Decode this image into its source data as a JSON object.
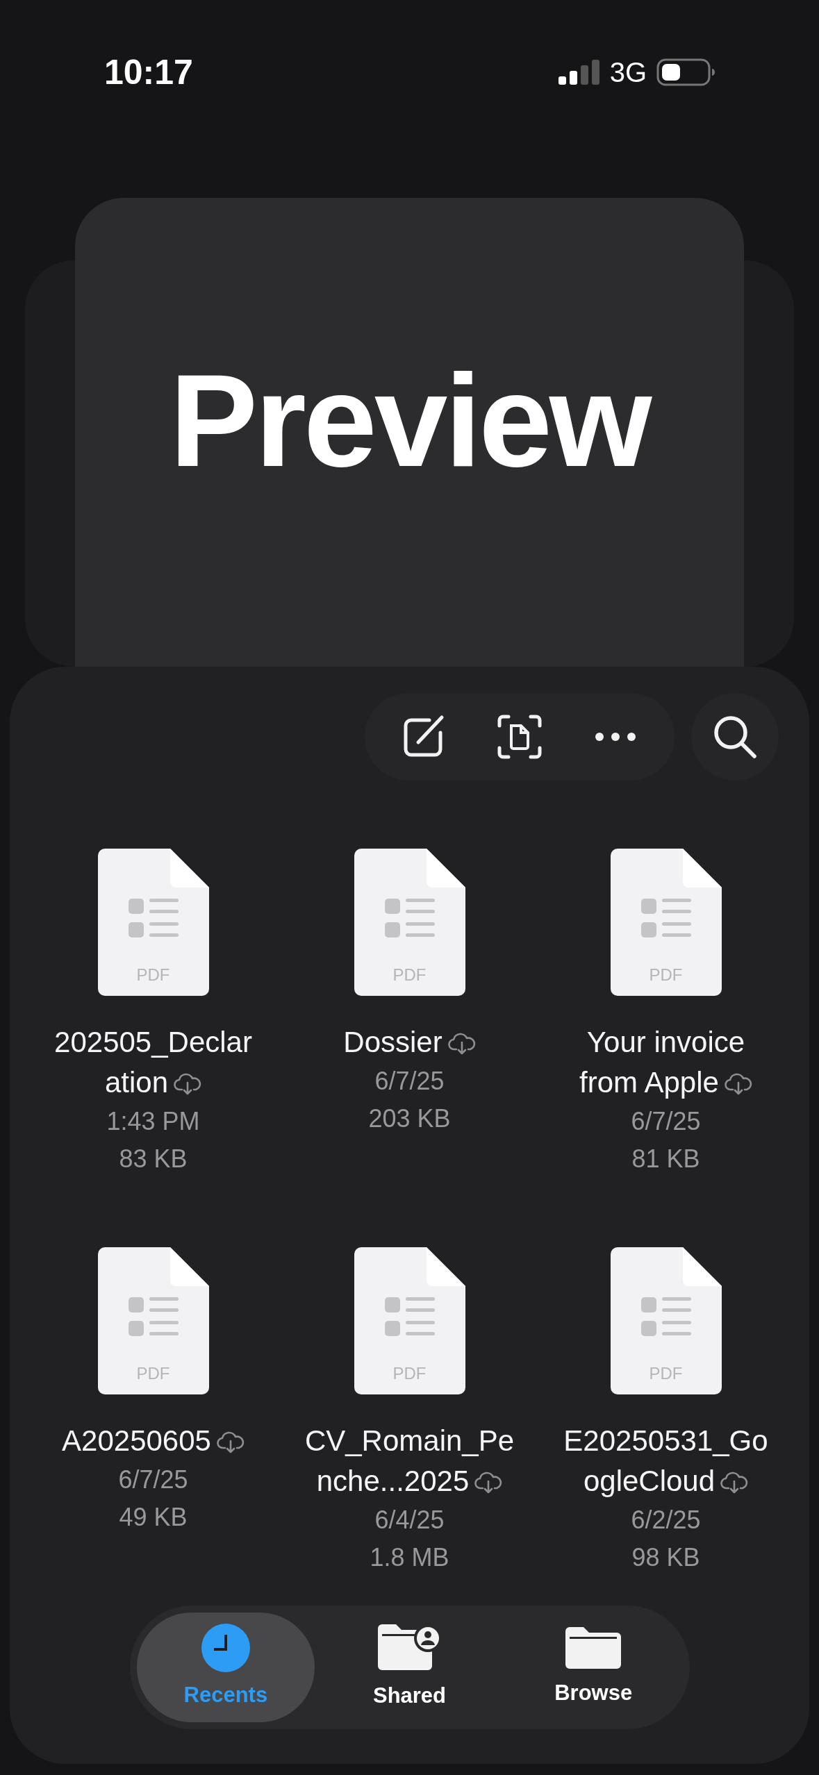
{
  "status_bar": {
    "time": "10:17",
    "network": "3G"
  },
  "preview": {
    "title": "Preview"
  },
  "files": [
    {
      "type_label": "PDF",
      "name": "202505_Declaration",
      "in_cloud": true,
      "date": "1:43 PM",
      "size": "83 KB"
    },
    {
      "type_label": "PDF",
      "name": "Dossier",
      "in_cloud": true,
      "date": "6/7/25",
      "size": "203 KB"
    },
    {
      "type_label": "PDF",
      "name": "Your invoice from Apple",
      "in_cloud": true,
      "date": "6/7/25",
      "size": "81 KB"
    },
    {
      "type_label": "PDF",
      "name": "A20250605",
      "in_cloud": true,
      "date": "6/7/25",
      "size": "49 KB"
    },
    {
      "type_label": "PDF",
      "name": "CV_Romain_Penche...2025",
      "in_cloud": true,
      "date": "6/4/25",
      "size": "1.8 MB"
    },
    {
      "type_label": "PDF",
      "name": "E20250531_GoogleCloud",
      "in_cloud": true,
      "date": "6/2/25",
      "size": "98 KB"
    }
  ],
  "tabs": [
    {
      "label": "Recents",
      "selected": true
    },
    {
      "label": "Shared",
      "selected": false
    },
    {
      "label": "Browse",
      "selected": false
    }
  ]
}
